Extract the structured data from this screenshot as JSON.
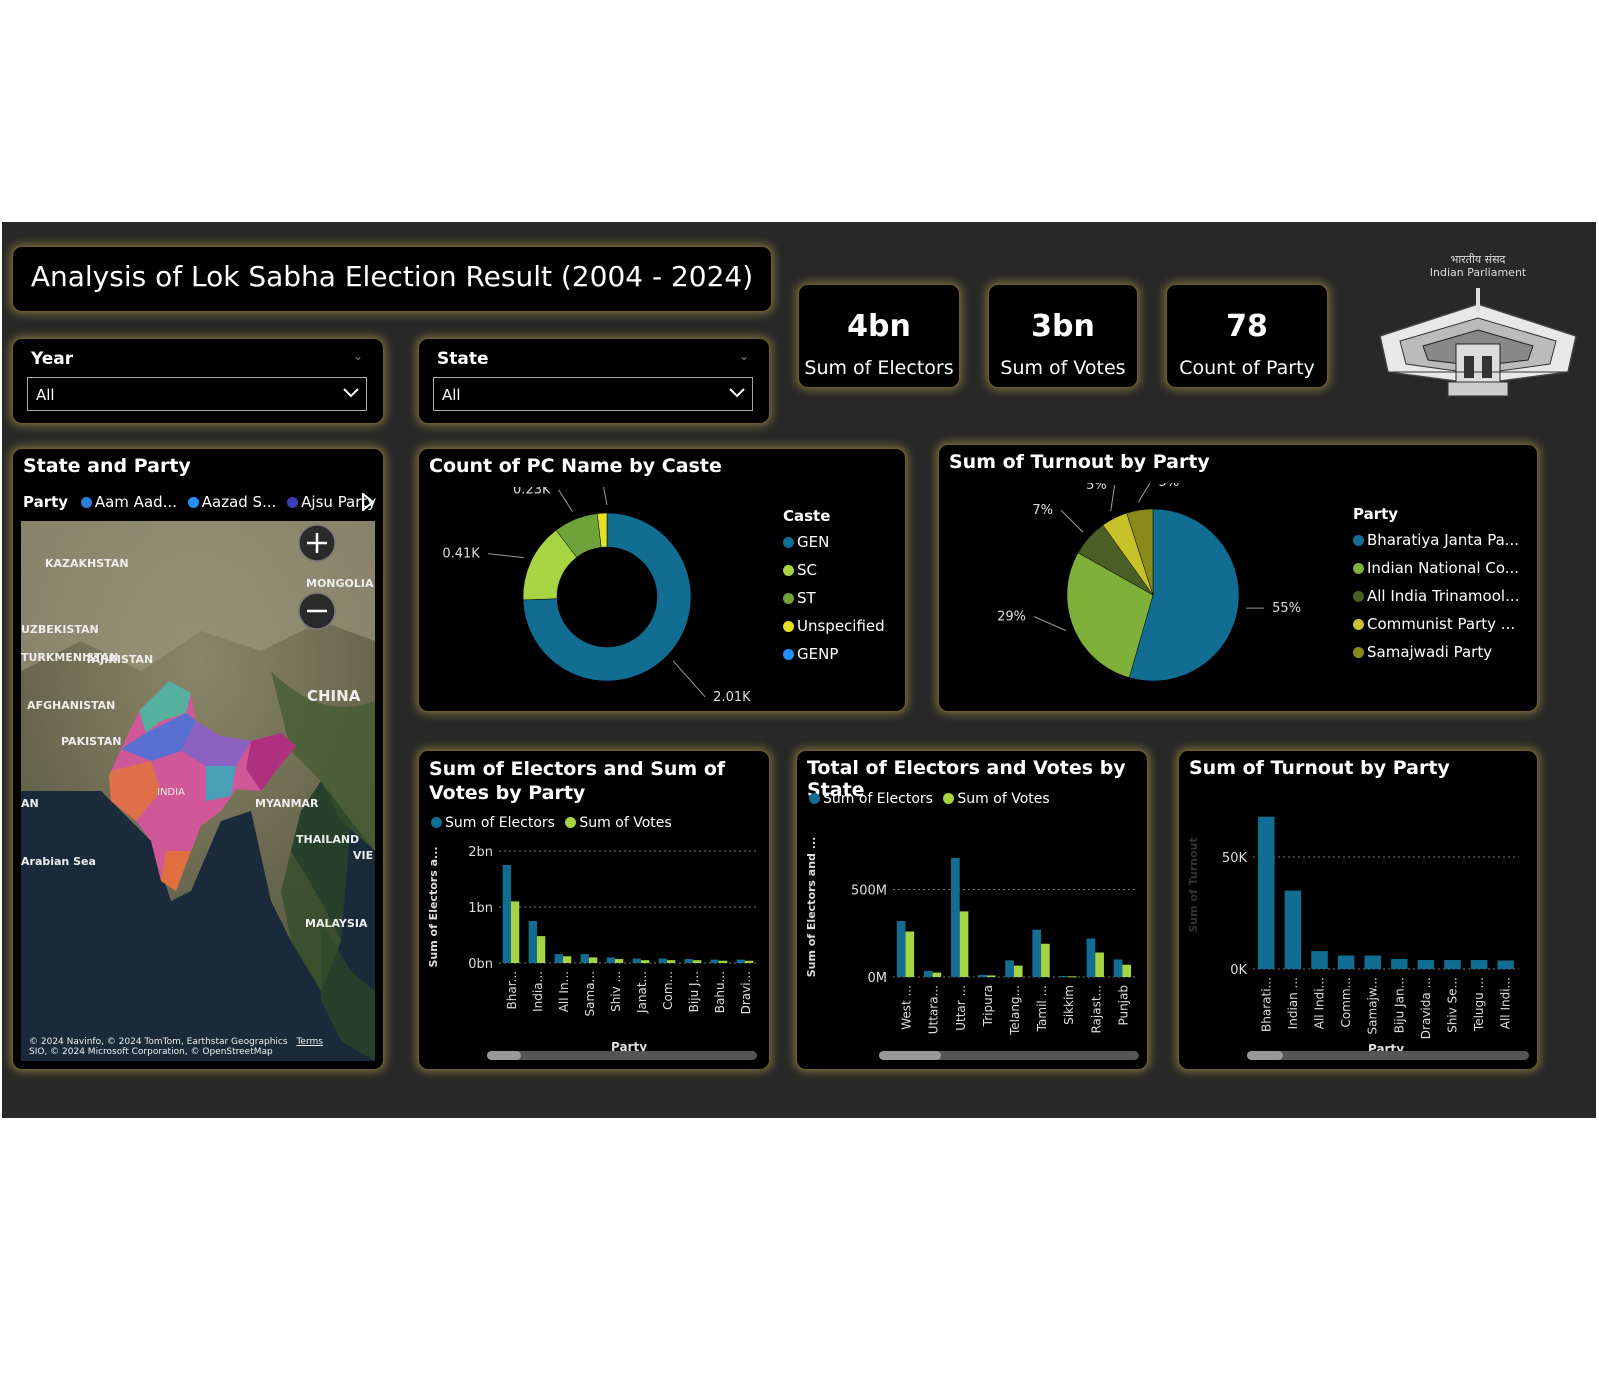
{
  "title": "Analysis of Lok Sabha Election Result (2004 - 2024)",
  "filters": {
    "year": {
      "label": "Year",
      "value": "All"
    },
    "state": {
      "label": "State",
      "value": "All"
    }
  },
  "kpis": [
    {
      "value": "4bn",
      "label": "Sum of Electors"
    },
    {
      "value": "3bn",
      "label": "Sum of Votes"
    },
    {
      "value": "78",
      "label": "Count of Party"
    }
  ],
  "logo": {
    "hindi": "भारतीय संसद",
    "english": "Indian Parliament"
  },
  "map": {
    "title": "State and Party",
    "legend_label": "Party",
    "legend_items": [
      {
        "name": "Aam Aad...",
        "color": "#2a7fd6"
      },
      {
        "name": "Aazad S...",
        "color": "#1e90ff"
      },
      {
        "name": "Ajsu Party",
        "color": "#3a3fb8"
      }
    ],
    "places": [
      "KAZAKHSTAN",
      "MONGOLIA",
      "UZBEKISTAN",
      "TURKMENISTAN",
      "TAJIKISTAN",
      "CHINA",
      "AFGHANISTAN",
      "PAKISTAN",
      "INDIA",
      "MYANMAR",
      "THAILAND",
      "Arabian Sea",
      "MALAYSIA",
      "VIE",
      "AN"
    ],
    "attribution1": "© 2024 Navinfo, © 2024 TomTom, Earthstar Geographics",
    "terms": "Terms",
    "attribution2": "SIO, © 2024 Microsoft Corporation, © OpenStreetMap"
  },
  "chart_data": [
    {
      "type": "pie",
      "variant": "donut",
      "title": "Count of PC Name by Caste",
      "legend_title": "Caste",
      "categories": [
        "GEN",
        "SC",
        "ST",
        "Unspecified",
        "GENP"
      ],
      "values": [
        2010,
        410,
        230,
        50,
        0
      ],
      "data_labels": [
        "2.01K",
        "0.41K",
        "0.23K",
        "",
        "0K"
      ],
      "colors": [
        "#126d93",
        "#a6d443",
        "#6ea23a",
        "#e6e022",
        "#1e90ff"
      ]
    },
    {
      "type": "pie",
      "title": "Sum of Turnout by Party",
      "legend_title": "Party",
      "categories": [
        "Bharatiya Janta Pa...",
        "Indian National Co...",
        "All India Trinamool...",
        "Communist Party ...",
        "Samajwadi Party"
      ],
      "values": [
        55,
        29,
        7,
        5,
        5
      ],
      "data_labels": [
        "55%",
        "29%",
        "7%",
        "5%",
        "5%"
      ],
      "colors": [
        "#126d93",
        "#7fb03a",
        "#4a5e26",
        "#c7c229",
        "#8a8a1a"
      ]
    },
    {
      "type": "bar",
      "title": "Sum of Electors and Sum of Votes by Party",
      "xlabel": "Party",
      "ylabel": "Sum of Electors a...",
      "categories": [
        "Bhar...",
        "India...",
        "All In...",
        "Sama...",
        "Shiv ...",
        "Janat...",
        "Com...",
        "Biju J...",
        "Bahu...",
        "Dravi..."
      ],
      "series": [
        {
          "name": "Sum of Electors",
          "values": [
            1.75,
            0.75,
            0.16,
            0.16,
            0.1,
            0.08,
            0.08,
            0.07,
            0.06,
            0.06
          ]
        },
        {
          "name": "Sum of Votes",
          "values": [
            1.1,
            0.48,
            0.12,
            0.1,
            0.07,
            0.05,
            0.05,
            0.05,
            0.04,
            0.04
          ]
        }
      ],
      "yticks": [
        "0bn",
        "1bn",
        "2bn"
      ],
      "ylim": [
        0,
        2
      ],
      "colors": [
        "#126d93",
        "#a6d443"
      ]
    },
    {
      "type": "bar",
      "title": "Total of Electors and Votes by State",
      "xlabel": "State",
      "ylabel": "Sum of Electors and ...",
      "categories": [
        "West ...",
        "Uttara...",
        "Uttar ...",
        "Tripura",
        "Telang...",
        "Tamil ...",
        "Sikkim",
        "Rajast...",
        "Punjab"
      ],
      "series": [
        {
          "name": "Sum of Electors",
          "values": [
            320,
            35,
            680,
            12,
            95,
            270,
            6,
            220,
            100
          ]
        },
        {
          "name": "Sum of Votes",
          "values": [
            260,
            25,
            375,
            9,
            65,
            190,
            4,
            140,
            70
          ]
        }
      ],
      "yticks": [
        "0M",
        "500M"
      ],
      "ylim": [
        0,
        800
      ],
      "colors": [
        "#126d93",
        "#a6d443"
      ]
    },
    {
      "type": "bar",
      "title": "Sum of Turnout by Party",
      "xlabel": "Party",
      "ylabel": "Sum of Turnout",
      "categories": [
        "Bharati...",
        "Indian ...",
        "All Indi...",
        "Comm...",
        "Samajw...",
        "Biju Jan...",
        "Dravida ...",
        "Shiv Se...",
        "Telugu ...",
        "All Indi..."
      ],
      "series": [
        {
          "name": "Sum of Turnout",
          "values": [
            68000,
            35000,
            8000,
            6000,
            6000,
            4500,
            4000,
            4000,
            4000,
            3800
          ]
        }
      ],
      "yticks": [
        "0K",
        "50K"
      ],
      "ylim": [
        0,
        75000
      ],
      "colors": [
        "#126d93"
      ]
    }
  ]
}
